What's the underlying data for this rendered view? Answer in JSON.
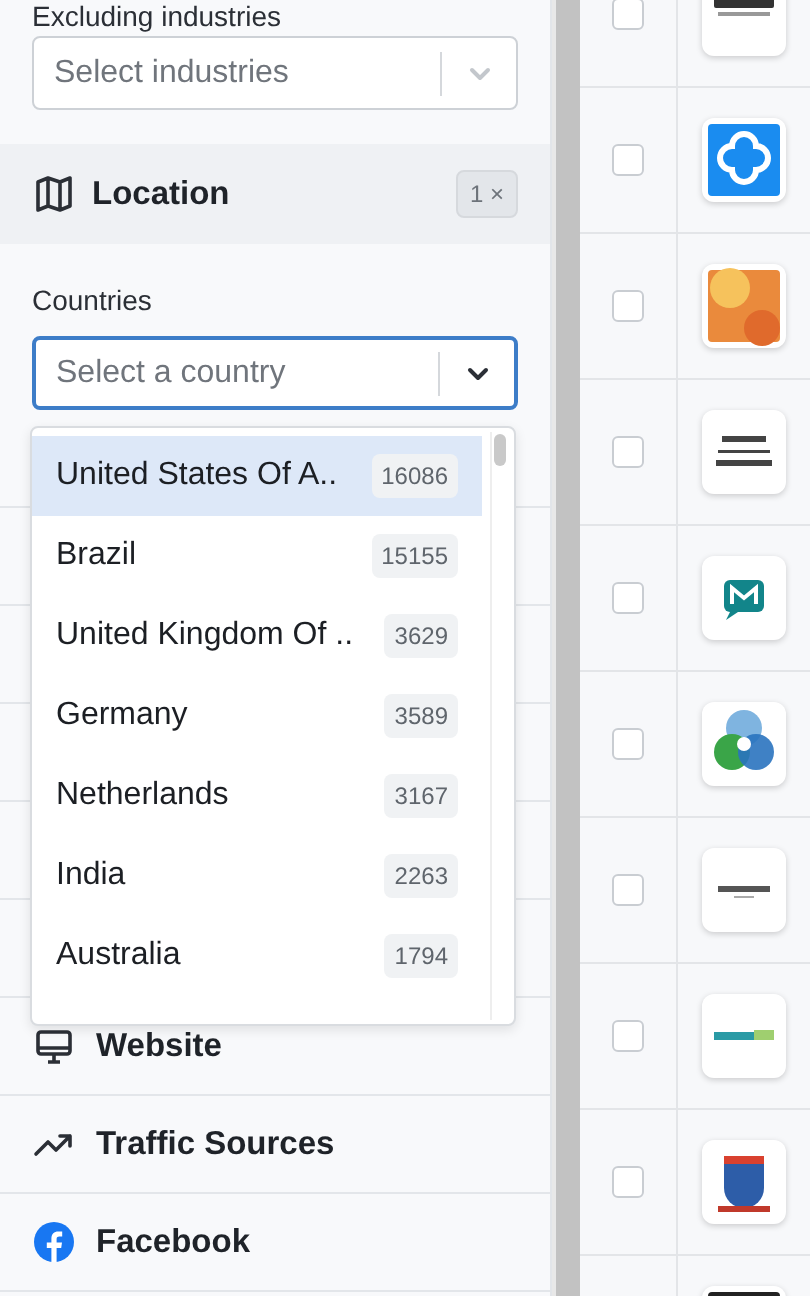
{
  "filters": {
    "excluding_industries": {
      "label": "Excluding industries",
      "placeholder": "Select industries"
    },
    "location": {
      "title": "Location",
      "count": "1",
      "clear": "×",
      "expanded": true
    },
    "countries": {
      "label": "Countries",
      "placeholder": "Select a country",
      "focused": true
    },
    "country_options": [
      {
        "name": "United States Of A..",
        "count": "16086",
        "selected": true
      },
      {
        "name": "Brazil",
        "count": "15155",
        "selected": false
      },
      {
        "name": "United Kingdom Of ..",
        "count": "3629",
        "selected": false
      },
      {
        "name": "Germany",
        "count": "3589",
        "selected": false
      },
      {
        "name": "Netherlands",
        "count": "3167",
        "selected": false
      },
      {
        "name": "India",
        "count": "2263",
        "selected": false
      },
      {
        "name": "Australia",
        "count": "1794",
        "selected": false
      }
    ],
    "sections": [
      {
        "title": "Website",
        "kind": "monitor"
      },
      {
        "title": "Traffic Sources",
        "kind": "trend"
      },
      {
        "title": "Facebook",
        "kind": "facebook"
      }
    ]
  },
  "table": {
    "rows": [
      {
        "checked": false,
        "kind": "wordmark"
      },
      {
        "checked": false,
        "kind": "blue-square"
      },
      {
        "checked": false,
        "kind": "orange"
      },
      {
        "checked": false,
        "kind": "lines"
      },
      {
        "checked": false,
        "kind": "teal"
      },
      {
        "checked": false,
        "kind": "circles"
      },
      {
        "checked": false,
        "kind": "thinline"
      },
      {
        "checked": false,
        "kind": "greenline"
      },
      {
        "checked": false,
        "kind": "shield"
      },
      {
        "kind": "dark"
      }
    ]
  }
}
